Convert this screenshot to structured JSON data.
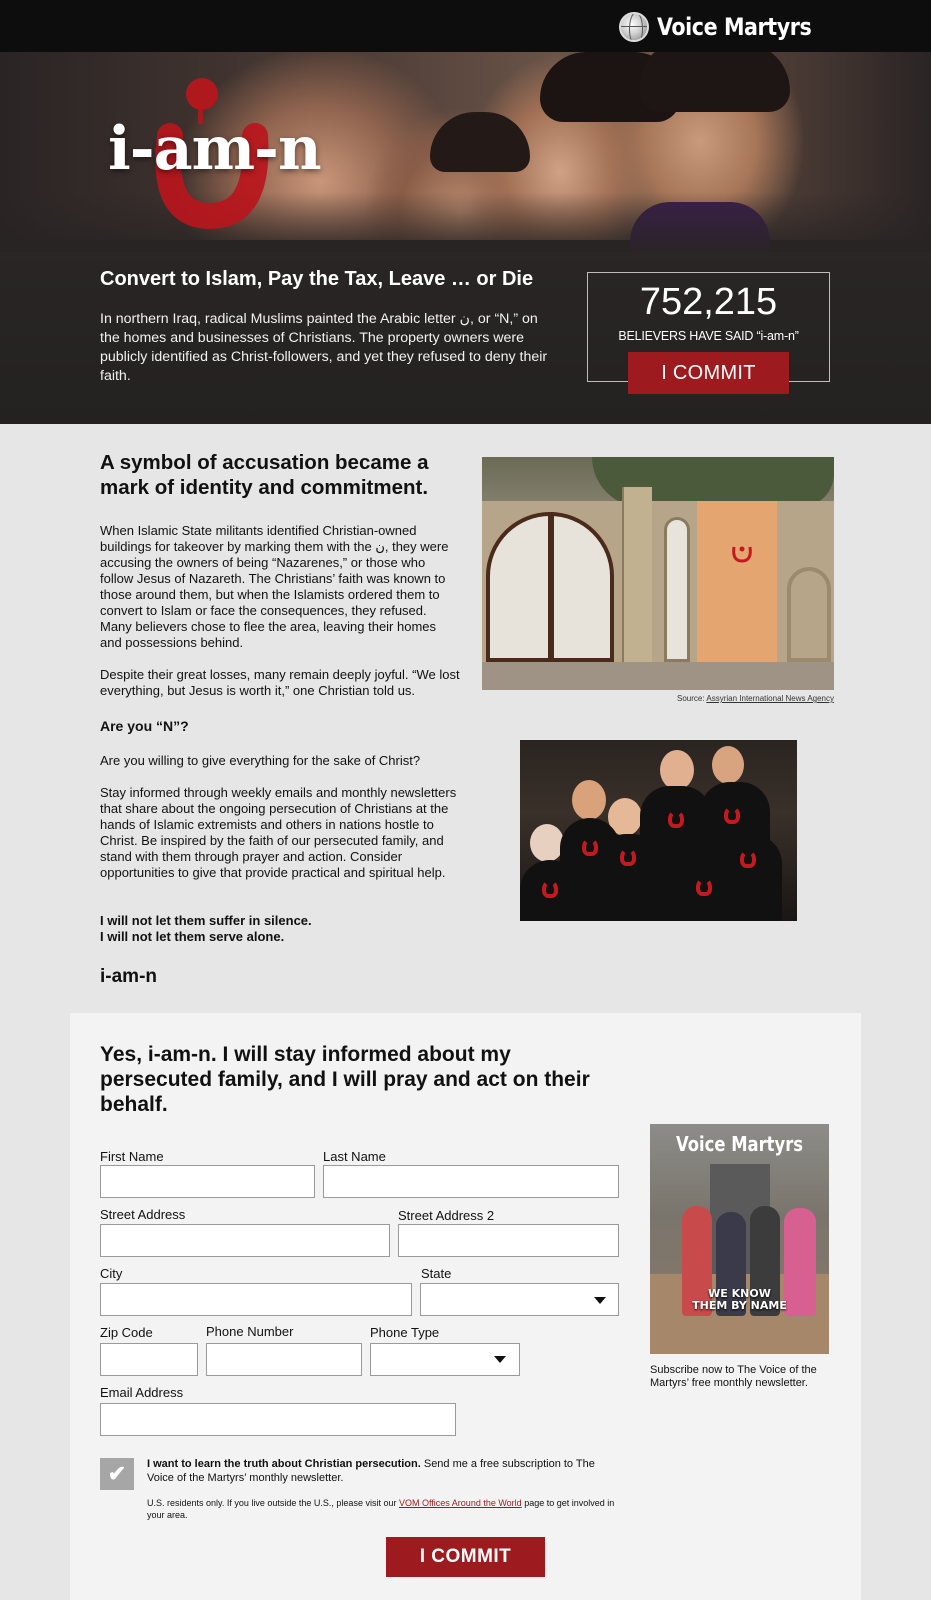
{
  "header": {
    "logo_text": "Voice Martyrs",
    "logo_icon": "globe-icon"
  },
  "hero": {
    "brand_title": "i-am-n",
    "heading": "Convert to Islam, Pay the Tax, Leave … or Die",
    "body": "In northern Iraq, radical Muslims painted the Arabic letter ن, or “N,” on the homes and businesses of Christians. The property owners were publicly identified as Christ-followers, and yet they refused to deny their faith.",
    "counter_value": "752,215",
    "counter_label": "BELIEVERS HAVE SAID “i-am-n”",
    "commit_label": "I COMMIT"
  },
  "main": {
    "heading": "A symbol of accusation became a mark of identity and commitment.",
    "p1": "When Islamic State militants identified Christian-owned buildings for takeover by marking them with the ن, they were accusing the owners of being “Nazarenes,” or those who follow Jesus of Nazareth. The Christians’ faith was known to those around them, but when the Islamists ordered them to convert to Islam or face the consequences, they refused. Many believers chose to flee the area, leaving their homes and possessions behind.",
    "p2": "Despite their great losses, many remain deeply joyful. “We lost everything, but Jesus is worth it,” one Christian told us.",
    "question": "Are you “N”?",
    "p3": "Are you willing to give everything for the sake of Christ?",
    "p4": "Stay informed through weekly emails and monthly newsletters that share about the ongoing persecution of Christians at the hands of Islamic extremists and others in nations hostle to Christ. Be inspired by the faith of our persecuted family, and stand with them through prayer and action. Consider opportunities to give that provide practical and spiritual help.",
    "pledge1": "I will not let them suffer in silence.",
    "pledge2": "I will not let them serve alone.",
    "signoff": "i-am-n",
    "source_prefix": "Source: ",
    "source_link": "Assyrian International News Agency"
  },
  "form": {
    "heading": "Yes, i-am-n. I will stay informed about my persecuted family, and I will pray and act on their behalf.",
    "first_name_label": "First Name",
    "first_name_value": "",
    "last_name_label": "Last Name",
    "last_name_value": "",
    "street_label": "Street Address",
    "street_value": "",
    "street2_label": "Street Address 2",
    "street2_value": "",
    "city_label": "City",
    "city_value": "",
    "state_label": "State",
    "state_value": "",
    "zip_label": "Zip Code",
    "zip_value": "",
    "phone_label": "Phone Number",
    "phone_value": "",
    "phone_type_label": "Phone Type",
    "phone_type_value": "",
    "email_label": "Email Address",
    "email_value": "",
    "checkbox_checked": true,
    "checkbox_bold": "I want to learn the truth about Christian persecution.",
    "checkbox_rest": " Send me a free subscription to The Voice of the Martyrs’ monthly newsletter.",
    "note_prefix": "U.S. residents only. If you live outside the U.S., please visit our ",
    "note_link": "VOM Offices Around the World",
    "note_suffix": " page to get involved in your area.",
    "commit_label": "I COMMIT"
  },
  "magazine": {
    "title": "Voice Martyrs",
    "subtitle_line1": "WE KNOW",
    "subtitle_line2": "THEM BY NAME",
    "caption": "Subscribe now to The Voice of the Martyrs’ free monthly newsletter."
  },
  "colors": {
    "accent": "#9d1b1e",
    "topbar": "#0d0d0d",
    "hero_bg": "#2a2626",
    "page_bg": "#e6e6e6",
    "panel_bg": "#f3f3f3"
  }
}
